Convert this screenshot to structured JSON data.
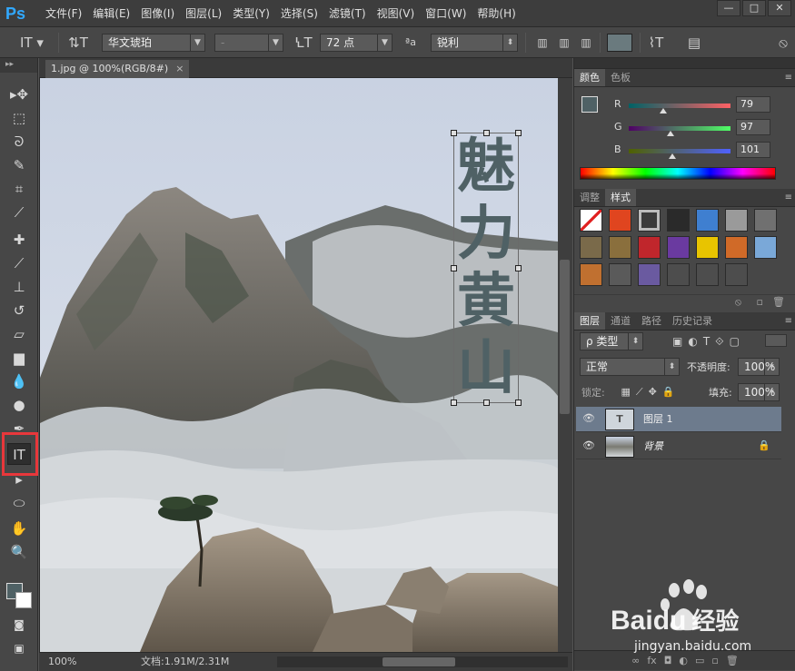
{
  "app": {
    "logo": "Ps"
  },
  "menu": [
    "文件(F)",
    "编辑(E)",
    "图像(I)",
    "图层(L)",
    "类型(Y)",
    "选择(S)",
    "滤镜(T)",
    "视图(V)",
    "窗口(W)",
    "帮助(H)"
  ],
  "window_controls": {
    "minimize": "—",
    "maximize": "□",
    "close": "✕"
  },
  "options": {
    "font_family": "华文琥珀",
    "font_style": "-",
    "font_size": "72 点",
    "antialias_label": "ªa",
    "antialias": "锐利",
    "text_color": "#6a7a7e"
  },
  "document": {
    "tab_title": "1.jpg @ 100%(RGB/8#)",
    "tab_close": "×",
    "vertical_text": [
      "魅",
      "力",
      "黄",
      "山"
    ],
    "text_color": "#4f6165"
  },
  "status": {
    "zoom": "100%",
    "doc_info": "文档:1.91M/2.31M"
  },
  "color_panel": {
    "tabs": [
      "颜色",
      "色板"
    ],
    "channels": [
      {
        "label": "R",
        "value": "79"
      },
      {
        "label": "G",
        "value": "97"
      },
      {
        "label": "B",
        "value": "101"
      }
    ],
    "foreground": "#4f6165",
    "background": "#ffffff"
  },
  "styles_panel": {
    "tabs": [
      "调整",
      "样式"
    ],
    "swatches": [
      "#ffffff",
      "#e0451f",
      "#3a3a3a",
      "#2a2a2a",
      "#3f7fd0",
      "#9a9a9a",
      "#707070",
      "#7a6a4a",
      "#8a6f3d",
      "#c0262c",
      "#6a3aa0",
      "#e8c400",
      "#d06a28",
      "#7aa8d8",
      "#c07030",
      "#5a5a5a",
      "#6a5aa0",
      "#4d4d4d",
      "#4d4d4d",
      "#4d4d4d"
    ]
  },
  "layers_panel": {
    "tabs": [
      "图层",
      "通道",
      "路径",
      "历史记录"
    ],
    "filter_label": "ρ 类型",
    "blend_mode": "正常",
    "opacity_label": "不透明度:",
    "opacity": "100%",
    "lock_label": "锁定:",
    "fill_label": "填充:",
    "fill": "100%",
    "layers": [
      {
        "name": "图层 1",
        "type": "text",
        "selected": true
      },
      {
        "name": "背景",
        "type": "image",
        "selected": false
      }
    ],
    "footer_icons": [
      "∞",
      "fx",
      "◘",
      "◐",
      "▭",
      "▫",
      "🗑"
    ]
  },
  "watermark": {
    "brand": "Bai",
    "brand2": "du",
    "cn": "经验",
    "url": "jingyan.baidu.com"
  }
}
